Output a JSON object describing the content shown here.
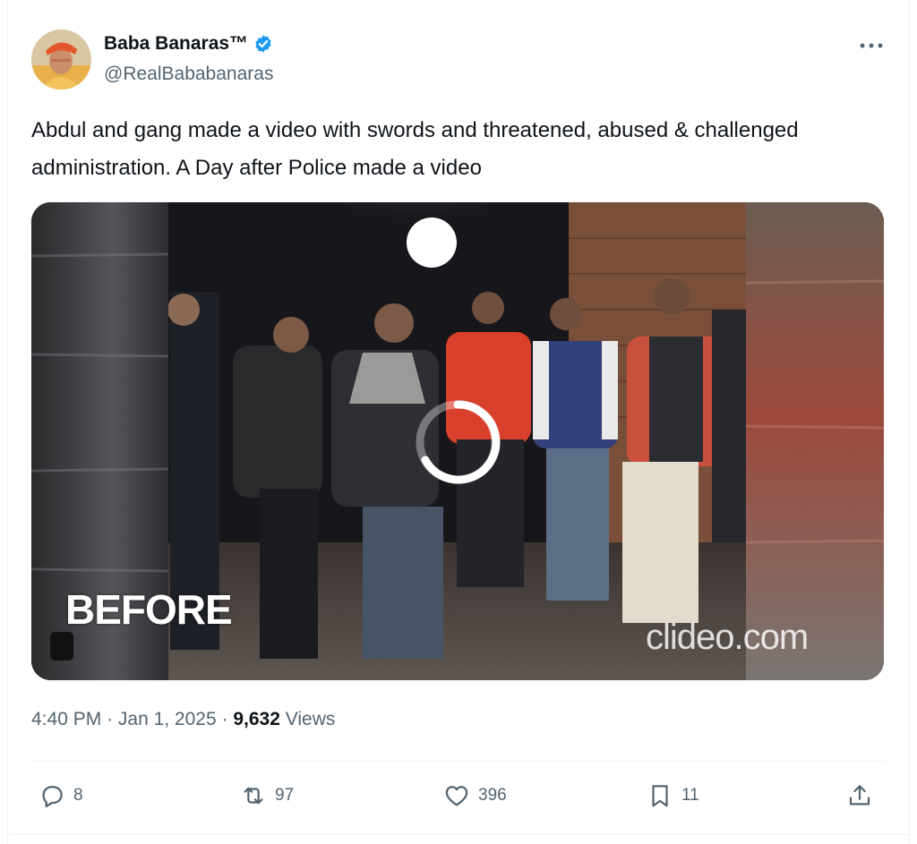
{
  "tweet": {
    "author": {
      "display_name": "Baba Banaras™",
      "handle": "@RealBababanaras",
      "verified": true,
      "avatar_icon": "profile-photo"
    },
    "more_icon": "ellipsis-icon",
    "text": "Abdul and gang made a video with swords and threatened, abused & challenged administration. A Day after Police made a video",
    "media": {
      "type": "video",
      "overlay_label": "BEFORE",
      "watermark": "clideo.com",
      "loading_icon": "loading-spinner-icon"
    },
    "time": "4:40 PM",
    "separator": "·",
    "date": "Jan 1, 2025",
    "views_count": "9,632",
    "views_label": "Views"
  },
  "actions": {
    "replies": "8",
    "retweets": "97",
    "likes": "396",
    "bookmarks": "11"
  },
  "colors": {
    "text_primary": "#0f1419",
    "text_secondary": "#536471",
    "verified_blue": "#1d9bf0",
    "divider": "#eff3f4"
  }
}
